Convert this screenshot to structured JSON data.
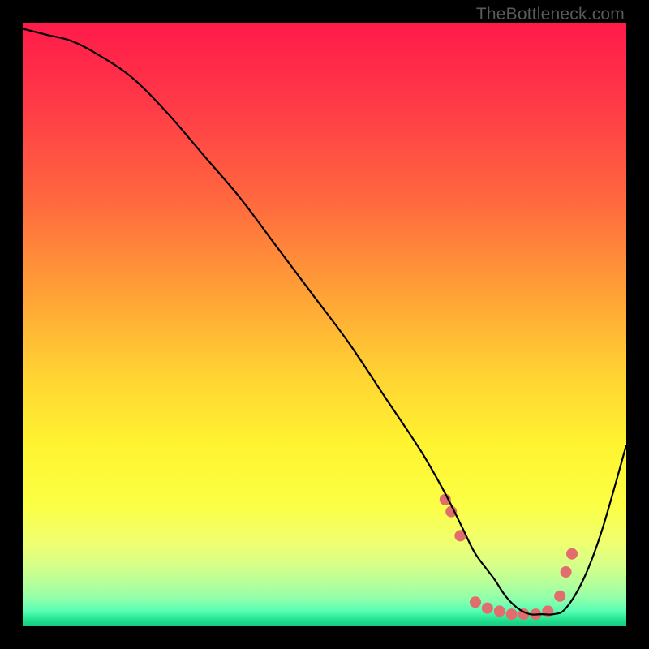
{
  "watermark": "TheBottleneck.com",
  "chart_data": {
    "type": "line",
    "title": "",
    "xlabel": "",
    "ylabel": "",
    "xlim": [
      0,
      100
    ],
    "ylim": [
      0,
      100
    ],
    "grid": false,
    "legend": false,
    "gradient_stops": [
      {
        "pct": 0,
        "color": "#ff1a4a"
      },
      {
        "pct": 14,
        "color": "#ff3b47"
      },
      {
        "pct": 30,
        "color": "#ff6a3e"
      },
      {
        "pct": 45,
        "color": "#ffa236"
      },
      {
        "pct": 58,
        "color": "#ffd233"
      },
      {
        "pct": 70,
        "color": "#fff430"
      },
      {
        "pct": 80,
        "color": "#fbff45"
      },
      {
        "pct": 86,
        "color": "#f0ff6e"
      },
      {
        "pct": 90,
        "color": "#d6ff8a"
      },
      {
        "pct": 93,
        "color": "#b4ff9a"
      },
      {
        "pct": 95.5,
        "color": "#8dffab"
      },
      {
        "pct": 97.5,
        "color": "#57ffb4"
      },
      {
        "pct": 99,
        "color": "#1fe08d"
      },
      {
        "pct": 100,
        "color": "#18c97e"
      }
    ],
    "series": [
      {
        "name": "bottleneck-curve",
        "color": "#000000",
        "x": [
          0,
          4,
          8,
          12,
          18,
          24,
          30,
          36,
          42,
          48,
          54,
          60,
          66,
          70,
          73,
          75,
          78,
          80,
          82,
          84,
          86,
          88,
          90,
          93,
          96,
          100
        ],
        "values": [
          99,
          98,
          97,
          95,
          91,
          85,
          78,
          71,
          63,
          55,
          47,
          38,
          29,
          22,
          16,
          12,
          8,
          5,
          3,
          2,
          2,
          2,
          3,
          8,
          16,
          30
        ]
      }
    ],
    "markers": {
      "name": "highlight-dots",
      "color": "#e26d6d",
      "radius": 7,
      "points": [
        {
          "x": 70,
          "y": 21
        },
        {
          "x": 71,
          "y": 19
        },
        {
          "x": 72.5,
          "y": 15
        },
        {
          "x": 75,
          "y": 4
        },
        {
          "x": 77,
          "y": 3
        },
        {
          "x": 79,
          "y": 2.5
        },
        {
          "x": 81,
          "y": 2
        },
        {
          "x": 83,
          "y": 2
        },
        {
          "x": 85,
          "y": 2
        },
        {
          "x": 87,
          "y": 2.5
        },
        {
          "x": 89,
          "y": 5
        },
        {
          "x": 90,
          "y": 9
        },
        {
          "x": 91,
          "y": 12
        }
      ]
    }
  }
}
